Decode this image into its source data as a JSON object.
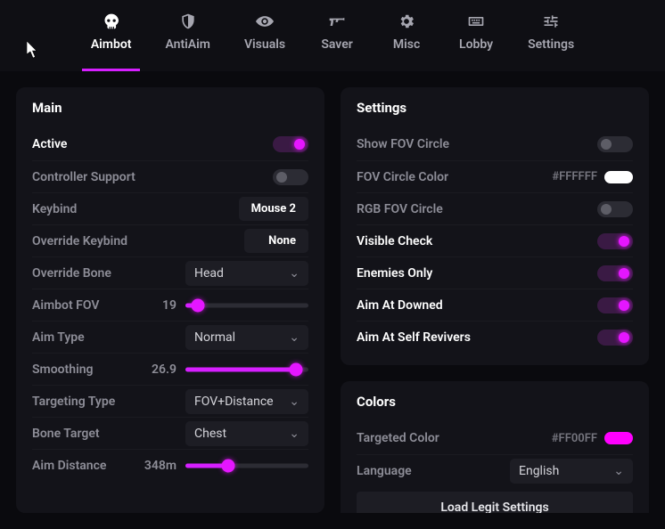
{
  "nav": {
    "items": [
      {
        "label": "Aimbot",
        "active": true
      },
      {
        "label": "AntiAim",
        "active": false
      },
      {
        "label": "Visuals",
        "active": false
      },
      {
        "label": "Saver",
        "active": false
      },
      {
        "label": "Misc",
        "active": false
      },
      {
        "label": "Lobby",
        "active": false
      },
      {
        "label": "Settings",
        "active": false
      }
    ]
  },
  "main": {
    "title": "Main",
    "active_label": "Active",
    "controller_label": "Controller Support",
    "keybind_label": "Keybind",
    "keybind_value": "Mouse 2",
    "override_keybind_label": "Override Keybind",
    "override_keybind_value": "None",
    "override_bone_label": "Override Bone",
    "override_bone_value": "Head",
    "aimbot_fov_label": "Aimbot FOV",
    "aimbot_fov_value": "19",
    "aim_type_label": "Aim Type",
    "aim_type_value": "Normal",
    "smoothing_label": "Smoothing",
    "smoothing_value": "26.9",
    "targeting_type_label": "Targeting Type",
    "targeting_type_value": "FOV+Distance",
    "bone_target_label": "Bone Target",
    "bone_target_value": "Chest",
    "aim_distance_label": "Aim Distance",
    "aim_distance_value": "348m"
  },
  "settings": {
    "title": "Settings",
    "show_fov_label": "Show FOV Circle",
    "fov_color_label": "FOV Circle Color",
    "fov_color_hex": "#FFFFFF",
    "fov_color_swatch": "#FFFFFF",
    "rgb_fov_label": "RGB FOV Circle",
    "visible_check_label": "Visible Check",
    "enemies_only_label": "Enemies Only",
    "aim_downed_label": "Aim At Downed",
    "aim_self_revivers_label": "Aim At Self Revivers"
  },
  "colors_section": {
    "title": "Colors",
    "targeted_color_label": "Targeted Color",
    "targeted_color_hex": "#FF00FF",
    "targeted_color_swatch": "#FF00FF",
    "language_label": "Language",
    "language_value": "English",
    "load_btn_label": "Load Legit Settings"
  },
  "accent": "#e516ff"
}
